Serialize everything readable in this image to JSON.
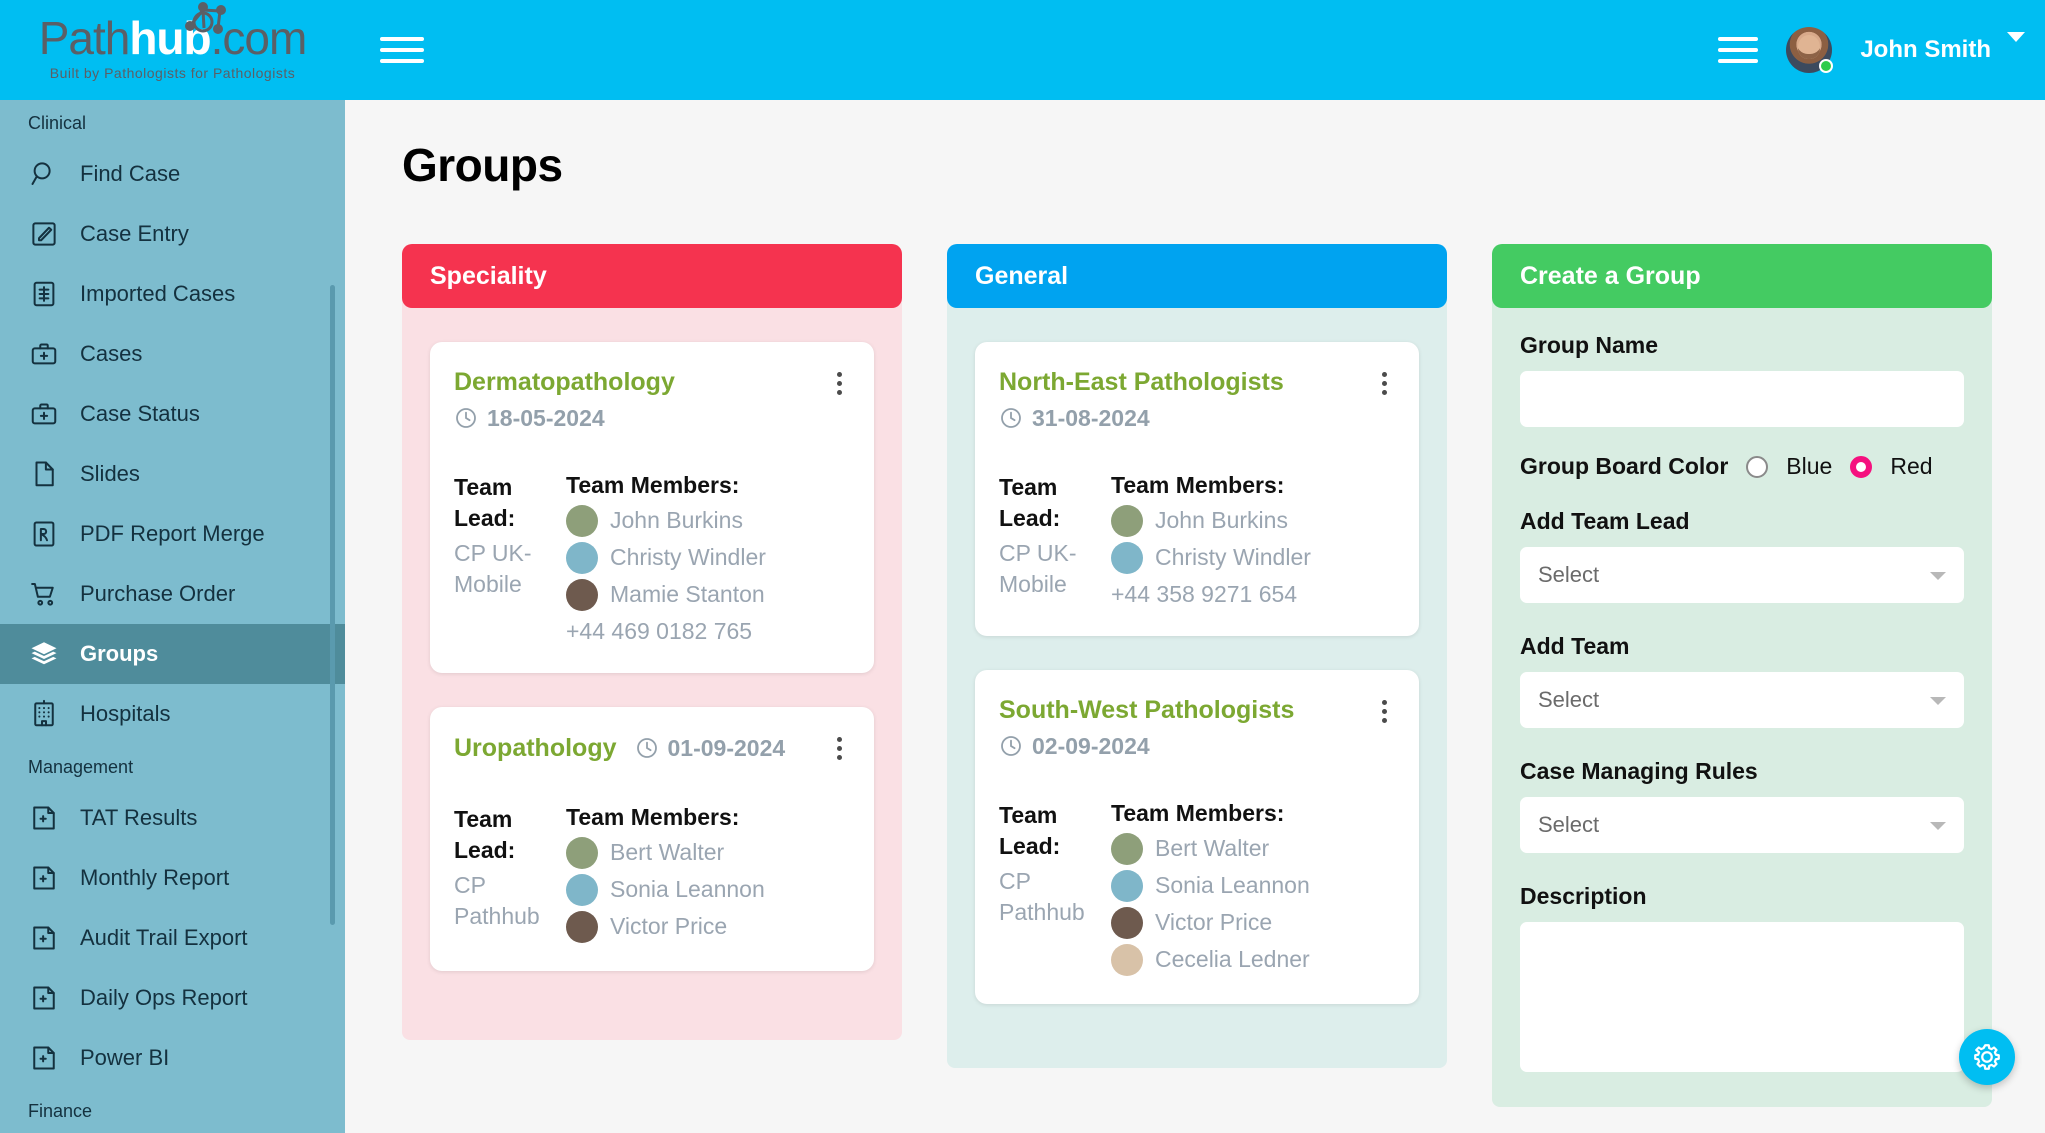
{
  "brand": {
    "name_part1": "Path",
    "name_part2": "hub",
    "name_part3": ".com",
    "tagline": "Built by Pathologists for Pathologists"
  },
  "header": {
    "menu_icon": "hamburger-icon",
    "right_menu_icon": "hamburger-icon",
    "user_name": "John Smith",
    "status": "online",
    "caret_icon": "chevron-down-icon"
  },
  "sidebar": {
    "sections": [
      {
        "label": "Clinical",
        "items": [
          {
            "label": "Find Case",
            "icon": "search-icon",
            "active": false
          },
          {
            "label": "Case Entry",
            "icon": "edit-square-icon",
            "active": false
          },
          {
            "label": "Imported Cases",
            "icon": "import-doc-icon",
            "active": false
          },
          {
            "label": "Cases",
            "icon": "medical-bag-icon",
            "active": false
          },
          {
            "label": "Case Status",
            "icon": "medical-bag-icon",
            "active": false
          },
          {
            "label": "Slides",
            "icon": "page-icon",
            "active": false
          },
          {
            "label": "PDF Report Merge",
            "icon": "pdf-icon",
            "active": false
          },
          {
            "label": "Purchase Order",
            "icon": "cart-icon",
            "active": false
          },
          {
            "label": "Groups",
            "icon": "layers-icon",
            "active": true
          },
          {
            "label": "Hospitals",
            "icon": "hospital-icon",
            "active": false
          }
        ]
      },
      {
        "label": "Management",
        "items": [
          {
            "label": "TAT Results",
            "icon": "report-plus-icon",
            "active": false
          },
          {
            "label": "Monthly Report",
            "icon": "report-plus-icon",
            "active": false
          },
          {
            "label": "Audit Trail Export",
            "icon": "report-plus-icon",
            "active": false
          },
          {
            "label": "Daily Ops Report",
            "icon": "report-plus-icon",
            "active": false
          },
          {
            "label": "Power BI",
            "icon": "report-plus-icon",
            "active": false
          }
        ]
      },
      {
        "label": "Finance",
        "items": []
      }
    ]
  },
  "page": {
    "title": "Groups"
  },
  "colors": {
    "brand_blue": "#00BEF2",
    "sidebar": "#7DBCCE",
    "sidebar_active": "#4F8C9B",
    "speciality_header": "#F5334F",
    "speciality_body": "#FAE0E4",
    "general_header": "#00A3F0",
    "general_body": "#DDEEEC",
    "create_header": "#44CB62",
    "create_body": "#D9EDE2",
    "card_title": "#7CA832",
    "radio_selected": "#F5117F"
  },
  "columns": [
    {
      "title": "Speciality",
      "header_color": "#F5334F",
      "body_color": "#FAE0E4",
      "cards": [
        {
          "title": "Dermatopathology",
          "date": "18-05-2024",
          "date_icon": "clock-icon",
          "menu_icon": "kebab-menu-icon",
          "inline_date": false,
          "lead_label": "Team Lead:",
          "lead_value": "CP UK-Mobile",
          "members_label": "Team Members:",
          "members": [
            "John Burkins",
            "Christy Windler",
            "Mamie Stanton"
          ],
          "phone": "+44 469 0182 765"
        },
        {
          "title": "Uropathology",
          "date": "01-09-2024",
          "date_icon": "clock-icon",
          "menu_icon": "kebab-menu-icon",
          "inline_date": true,
          "lead_label": "Team Lead:",
          "lead_value": "CP Pathhub",
          "members_label": "Team Members:",
          "members": [
            "Bert Walter",
            "Sonia Leannon",
            "Victor Price"
          ],
          "phone": ""
        }
      ]
    },
    {
      "title": "General",
      "header_color": "#00A3F0",
      "body_color": "#DDEEEC",
      "cards": [
        {
          "title": "North-East Pathologists",
          "date": "31-08-2024",
          "date_icon": "clock-icon",
          "menu_icon": "kebab-menu-icon",
          "inline_date": false,
          "lead_label": "Team Lead:",
          "lead_value": "CP UK-Mobile",
          "members_label": "Team Members:",
          "members": [
            "John Burkins",
            "Christy Windler"
          ],
          "phone": "+44 358 9271 654"
        },
        {
          "title": "South-West Pathologists",
          "date": "02-09-2024",
          "date_icon": "clock-icon",
          "menu_icon": "kebab-menu-icon",
          "inline_date": false,
          "lead_label": "Team Lead:",
          "lead_value": "CP Pathhub",
          "members_label": "Team Members:",
          "members": [
            "Bert Walter",
            "Sonia Leannon",
            "Victor Price",
            "Cecelia Ledner"
          ],
          "phone": ""
        }
      ]
    }
  ],
  "create_form": {
    "title": "Create a Group",
    "header_color": "#44CB62",
    "body_color": "#D9EDE2",
    "group_name_label": "Group Name",
    "group_name_value": "",
    "group_name_placeholder": "",
    "board_color_label": "Group Board Color",
    "board_color_options": [
      {
        "label": "Blue",
        "selected": false
      },
      {
        "label": "Red",
        "selected": true
      }
    ],
    "team_lead_label": "Add Team Lead",
    "team_lead_value": "Select",
    "team_label": "Add Team",
    "team_value": "Select",
    "rules_label": "Case Managing Rules",
    "rules_value": "Select",
    "description_label": "Description",
    "description_value": ""
  },
  "fab": {
    "icon": "gear-icon"
  }
}
